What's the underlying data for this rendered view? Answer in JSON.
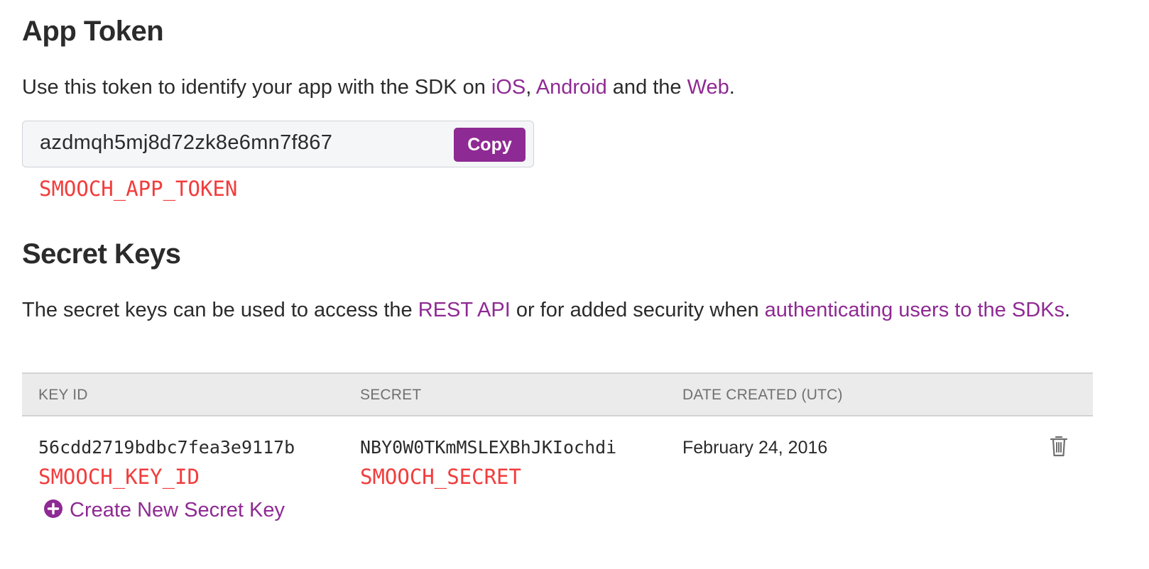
{
  "app_token": {
    "title": "App Token",
    "desc_pre": "Use this token to identify your app with the SDK on ",
    "link_ios": "iOS",
    "desc_sep": ", ",
    "link_android": "Android",
    "desc_mid": " and the ",
    "link_web": "Web",
    "desc_end": ".",
    "token_value": "azdmqh5mj8d72zk8e6mn7f867",
    "copy_label": "Copy",
    "env_var": "SMOOCH_APP_TOKEN"
  },
  "secret_keys": {
    "title": "Secret Keys",
    "desc_pre": "The secret keys can be used to access the ",
    "link_rest": "REST API",
    "desc_mid": " or for added security when ",
    "link_auth": "authenticating users to the SDKs",
    "desc_end": ".",
    "columns": [
      "KEY ID",
      "SECRET",
      "DATE CREATED (UTC)"
    ],
    "rows": [
      {
        "key_id": "56cdd2719bdbc7fea3e9117b",
        "key_id_env": "SMOOCH_KEY_ID",
        "secret": "NBY0W0TKmMSLEXBhJKIochdi",
        "secret_env": "SMOOCH_SECRET",
        "date_created": "February 24, 2016",
        "delete_icon": "trash-icon"
      }
    ],
    "create_label": "Create New Secret Key",
    "create_icon": "plus-circle-icon"
  },
  "colors": {
    "accent": "#8e2a93",
    "env_var": "#f23c3c",
    "header_bg": "#ebebeb"
  }
}
